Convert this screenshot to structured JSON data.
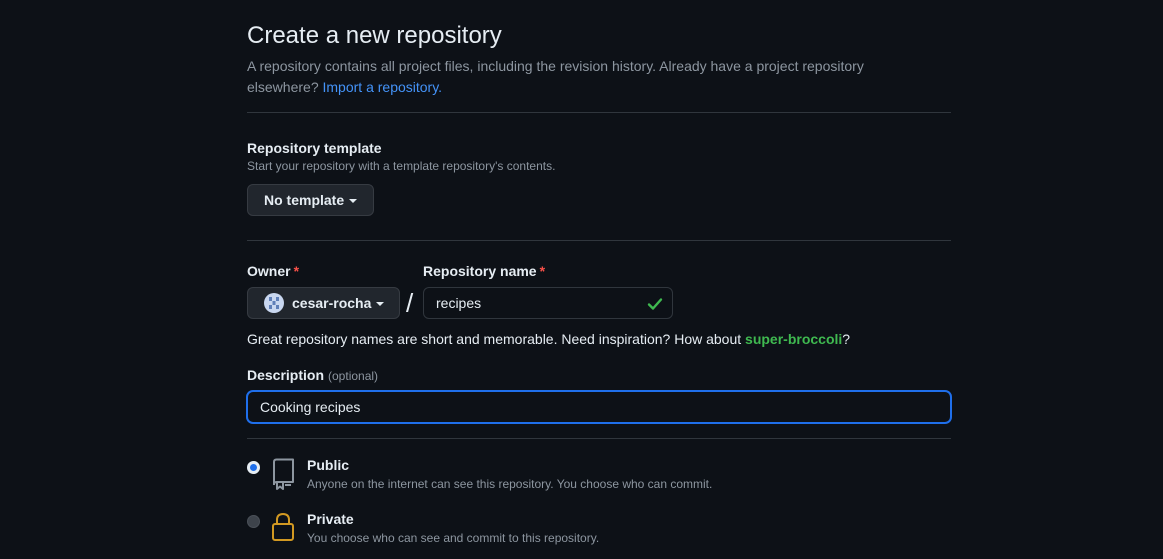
{
  "header": {
    "title": "Create a new repository",
    "subtitle": "A repository contains all project files, including the revision history. Already have a project repository elsewhere?",
    "import_link": "Import a repository."
  },
  "template": {
    "label": "Repository template",
    "note": "Start your repository with a template repository's contents.",
    "button_label": "No template"
  },
  "owner": {
    "label": "Owner",
    "required_mark": "*",
    "value": "cesar-rocha",
    "avatar_icon": "identicon"
  },
  "separator": "/",
  "repo_name": {
    "label": "Repository name",
    "required_mark": "*",
    "value": "recipes",
    "valid_icon": "check-icon"
  },
  "name_hint": {
    "text": "Great repository names are short and memorable. Need inspiration? How about",
    "suggestion": "super-broccoli",
    "end": "?"
  },
  "description": {
    "label": "Description",
    "optional": "(optional)",
    "value": "Cooking recipes"
  },
  "visibility": {
    "options": [
      {
        "title": "Public",
        "desc": "Anyone on the internet can see this repository. You choose who can commit.",
        "icon": "repo-icon",
        "checked": true
      },
      {
        "title": "Private",
        "desc": "You choose who can see and commit to this repository.",
        "icon": "lock-icon",
        "checked": false
      }
    ]
  },
  "colors": {
    "background": "#0d1117",
    "link": "#4493f8",
    "required": "#f85149",
    "success": "#3fb950",
    "focus": "#1f6feb",
    "lock": "#d29922"
  }
}
